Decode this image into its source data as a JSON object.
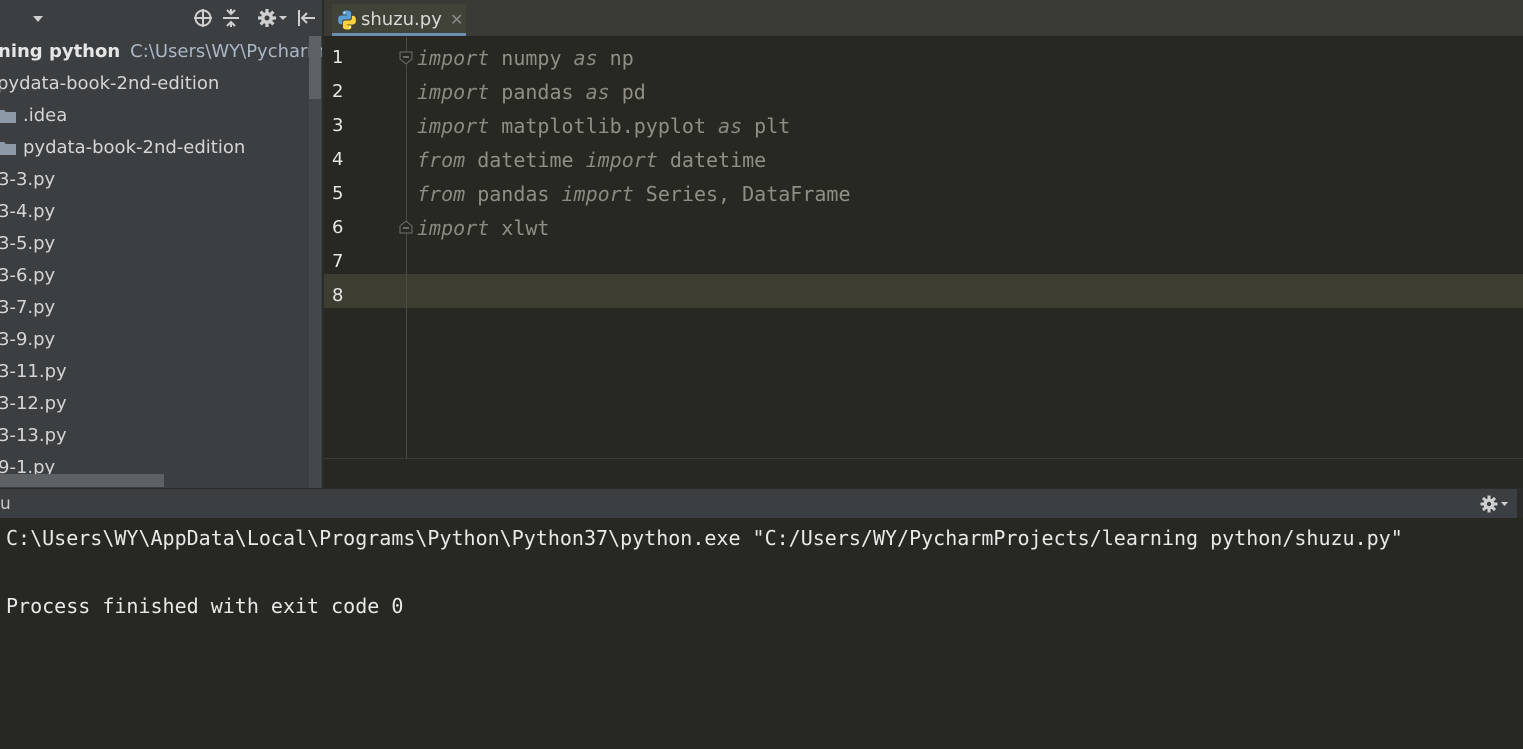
{
  "project_panel": {
    "root": {
      "name": "ning python",
      "path": "C:\\Users\\WY\\PycharmPro"
    },
    "items": [
      {
        "label": "pydata-book-2nd-edition",
        "indent": 0,
        "type": "folder-node"
      },
      {
        "label": ".idea",
        "indent": 1,
        "type": "folder"
      },
      {
        "label": "pydata-book-2nd-edition",
        "indent": 1,
        "type": "folder"
      },
      {
        "label": "3-3.py",
        "indent": 0,
        "type": "file"
      },
      {
        "label": "3-4.py",
        "indent": 0,
        "type": "file"
      },
      {
        "label": "3-5.py",
        "indent": 0,
        "type": "file"
      },
      {
        "label": "3-6.py",
        "indent": 0,
        "type": "file"
      },
      {
        "label": "3-7.py",
        "indent": 0,
        "type": "file"
      },
      {
        "label": "3-9.py",
        "indent": 0,
        "type": "file"
      },
      {
        "label": "3-11.py",
        "indent": 0,
        "type": "file"
      },
      {
        "label": "3-12.py",
        "indent": 0,
        "type": "file"
      },
      {
        "label": "3-13.py",
        "indent": 0,
        "type": "file"
      },
      {
        "label": "9-1.py",
        "indent": 0,
        "type": "file"
      }
    ]
  },
  "editor": {
    "tab": {
      "filename": "shuzu.py",
      "close": "✕"
    },
    "lines": [
      {
        "number": "1",
        "tokens": [
          {
            "t": "import",
            "kw": true
          },
          {
            "t": " numpy "
          },
          {
            "t": "as",
            "kw": true
          },
          {
            "t": " np"
          }
        ]
      },
      {
        "number": "2",
        "tokens": [
          {
            "t": "import",
            "kw": true
          },
          {
            "t": " pandas "
          },
          {
            "t": "as",
            "kw": true
          },
          {
            "t": " pd"
          }
        ]
      },
      {
        "number": "3",
        "tokens": [
          {
            "t": "import",
            "kw": true
          },
          {
            "t": " matplotlib.pyplot "
          },
          {
            "t": "as",
            "kw": true
          },
          {
            "t": " plt"
          }
        ]
      },
      {
        "number": "4",
        "tokens": [
          {
            "t": "from",
            "kw": true
          },
          {
            "t": " datetime "
          },
          {
            "t": "import",
            "kw": true
          },
          {
            "t": " datetime"
          }
        ]
      },
      {
        "number": "5",
        "tokens": [
          {
            "t": "from",
            "kw": true
          },
          {
            "t": " pandas "
          },
          {
            "t": "import",
            "kw": true
          },
          {
            "t": " Series, DataFrame"
          }
        ]
      },
      {
        "number": "6",
        "tokens": [
          {
            "t": "import",
            "kw": true
          },
          {
            "t": " xlwt"
          }
        ]
      },
      {
        "number": "7",
        "tokens": []
      },
      {
        "number": "8",
        "tokens": []
      }
    ],
    "current_line": "8"
  },
  "run_panel": {
    "title": "u",
    "console": [
      "C:\\Users\\WY\\AppData\\Local\\Programs\\Python\\Python37\\python.exe \"C:/Users/WY/PycharmProjects/learning python/shuzu.py\"",
      "",
      "Process finished with exit code 0"
    ]
  },
  "icons": {
    "toolbar": [
      "chevron-down-icon",
      "locate-icon",
      "collapse-all-icon",
      "gear-icon",
      "hide-panel-icon"
    ],
    "tab": "python-file-icon",
    "run": "gear-icon"
  },
  "colors": {
    "editor_bg": "#272822",
    "panel_bg": "#3c3f41",
    "current_line": "#3e3d32",
    "tab_underline": "#6a8fb0"
  }
}
